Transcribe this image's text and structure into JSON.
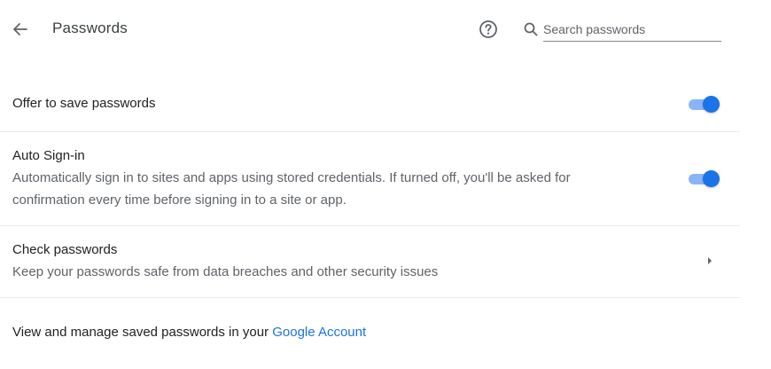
{
  "header": {
    "title": "Passwords",
    "back_icon": "arrow-left-icon",
    "help_icon": "help-circle-icon",
    "search": {
      "icon": "search-icon",
      "placeholder": "Search passwords",
      "value": ""
    }
  },
  "settings": {
    "offer_to_save": {
      "title": "Offer to save passwords",
      "enabled": true
    },
    "auto_sign_in": {
      "title": "Auto Sign-in",
      "description": "Automatically sign in to sites and apps using stored credentials. If turned off, you'll be asked for confirmation every time before signing in to a site or app.",
      "enabled": true
    },
    "check_passwords": {
      "title": "Check passwords",
      "description": "Keep your passwords safe from data breaches and other security issues",
      "icon": "chevron-right-icon"
    }
  },
  "footer": {
    "text": "View and manage saved passwords in your ",
    "link_label": "Google Account"
  },
  "colors": {
    "accent": "#1a73e8",
    "toggle_track": "#8ab4f8",
    "text_primary": "#202124",
    "text_secondary": "#5f6368",
    "divider": "#e8eaed"
  }
}
